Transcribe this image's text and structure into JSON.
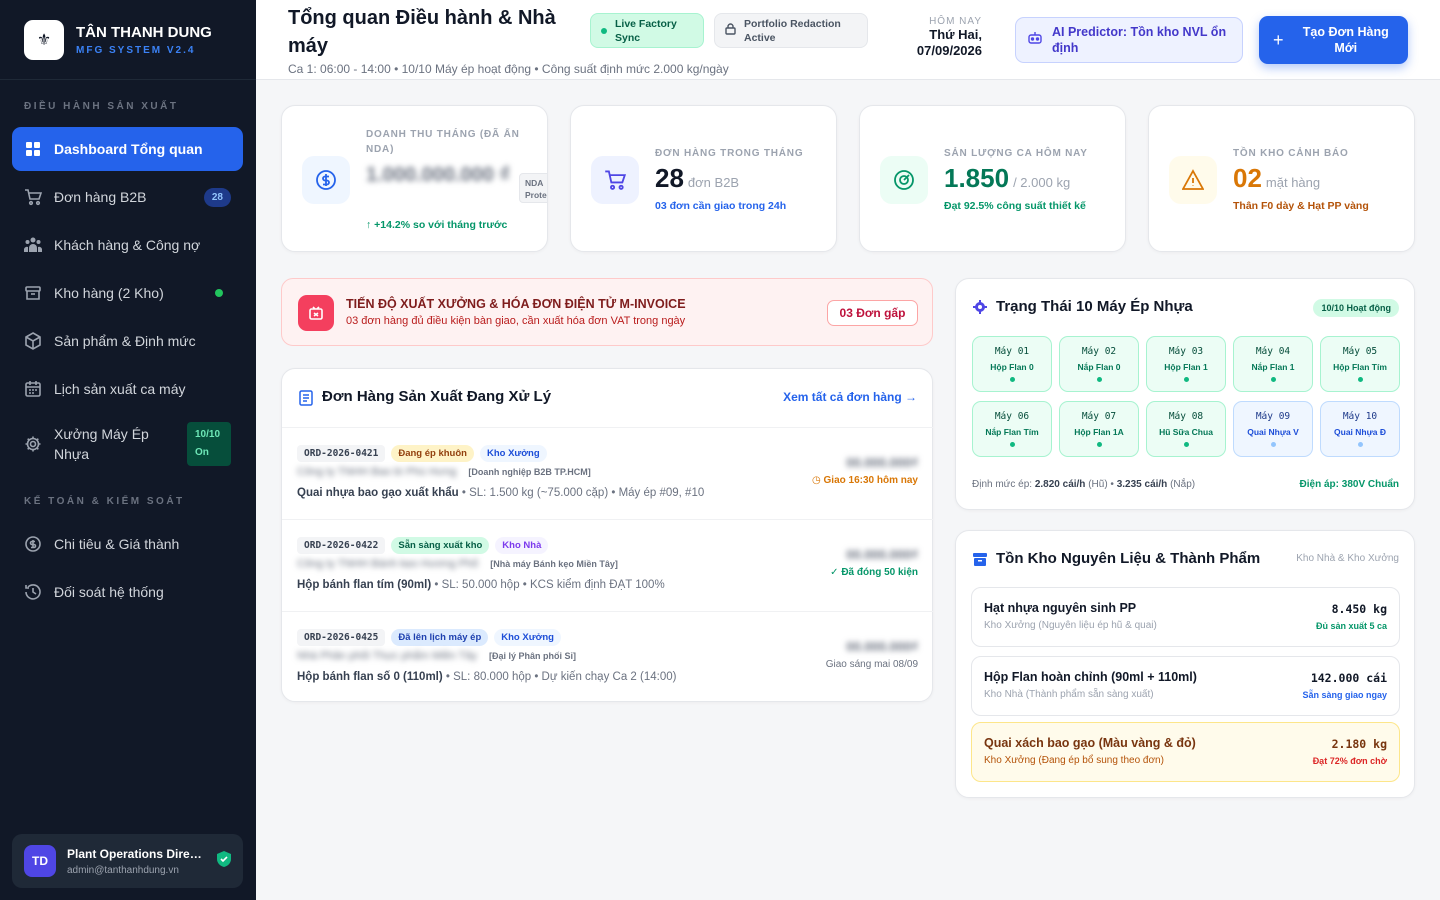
{
  "sidebar": {
    "brand_name": "TÂN THANH DUNG",
    "brand_sub": "MFG SYSTEM V2.4",
    "section1": "ĐIỀU HÀNH SẢN XUẤT",
    "section2": "KẾ TOÁN & KIỂM SOÁT",
    "items": [
      {
        "label": "Dashboard Tổng quan",
        "icon": "grid-icon"
      },
      {
        "label": "Đơn hàng B2B",
        "icon": "cart-icon",
        "badge": "28"
      },
      {
        "label": "Khách hàng & Công nợ",
        "icon": "users-icon"
      },
      {
        "label": "Kho hàng (2 Kho)",
        "icon": "archive-icon"
      },
      {
        "label": "Sản phẩm & Định mức",
        "icon": "box-icon"
      },
      {
        "label": "Lịch sản xuất ca máy",
        "icon": "calendar-icon"
      },
      {
        "label1": "Xưởng Máy Ép",
        "label2": "Nhựa",
        "icon": "gear-icon",
        "status1": "10/10",
        "status2": "On"
      },
      {
        "label": "Chi tiêu & Giá thành",
        "icon": "coin-icon"
      },
      {
        "label": "Đối soát hệ thống",
        "icon": "history-icon"
      }
    ],
    "user": {
      "initials": "TD",
      "name": "Plant Operations Director",
      "email": "admin@tanthanhdung.vn"
    }
  },
  "header": {
    "title": "Tổng quan Điều hành & Nhà máy",
    "subtitle": "Ca 1: 06:00 - 14:00 • 10/10 Máy ép hoạt động • Công suất định mức 2.000 kg/ngày",
    "chip_live_1": "Live Factory",
    "chip_live_2": "Sync",
    "chip_redact_1": "Portfolio Redaction",
    "chip_redact_2": "Active",
    "date_label": "HÔM NAY",
    "date_line1": "Thứ Hai,",
    "date_line2": "07/09/2026",
    "ai_text": "AI Predictor: Tồn kho NVL ổn định",
    "new_order_1": "Tạo Đơn Hàng",
    "new_order_2": "Mới"
  },
  "kpis": [
    {
      "label": "DOANH THU THÁNG (ĐÃ ẨN NDA)",
      "value": "1.000.000.000",
      "unit": "₫",
      "nda_1": "NDA",
      "nda_2": "Protected",
      "note": "+14.2% so với tháng trước",
      "color": "#059669"
    },
    {
      "label": "ĐƠN HÀNG TRONG THÁNG",
      "value": "28",
      "unit": "đơn B2B",
      "note": "03 đơn cần giao trong 24h",
      "color": "#2563eb"
    },
    {
      "label": "SẢN LƯỢNG CA HÔM NAY",
      "value": "1.850",
      "unit": "/ 2.000 kg",
      "note": "Đạt 92.5% công suất thiết kế",
      "color": "#059669"
    },
    {
      "label": "TỒN KHO CẢNH BÁO",
      "value": "02",
      "unit": "mặt hàng",
      "note": "Thân F0 dày & Hạt PP vàng",
      "color": "#d97706"
    }
  ],
  "alert": {
    "title": "TIẾN ĐỘ XUẤT XƯỞNG & HÓA ĐƠN ĐIỆN TỬ M-INVOICE",
    "subtitle": "03 đơn hàng đủ điều kiện bàn giao, cần xuất hóa đơn VAT trong ngày",
    "button": "03 Đơn gấp"
  },
  "orders": {
    "title": "Đơn Hàng Sản Xuất Đang Xử Lý",
    "view_all": "Xem tất cả đơn hàng →",
    "rows": [
      {
        "id": "ORD-2026-0421",
        "status": "Đang ép khuôn",
        "warehouse": "Kho Xưởng",
        "customer": "Công ty TNHH Bao bì Phú Hưng",
        "type": "[Doanh nghiệp B2B TP.HCM]",
        "product": "Quai nhựa bao gạo xuất khẩu",
        "details": " • SL: 1.500 kg (~75.000 cặp) • Máy ép #09, #10",
        "amount": "00.000.000₫",
        "deadline": "Giao 16:30 hôm nay"
      },
      {
        "id": "ORD-2026-0422",
        "status": "Sẵn sàng xuất kho",
        "warehouse": "Kho Nhà",
        "customer": "Công ty TNHH Bánh kẹo Hương Phố",
        "type": "[Nhà máy Bánh kẹo Miền Tây]",
        "product": "Hộp bánh flan tím (90ml)",
        "details": " • SL: 50.000 hộp • KCS kiểm định ĐẠT 100%",
        "amount": "00.000.000₫",
        "deadline": "Đã đóng 50 kiện"
      },
      {
        "id": "ORD-2026-0425",
        "status": "Đã lên lịch máy ép",
        "warehouse": "Kho Xưởng",
        "customer": "Nhà Phân phối Thực phẩm Miền Tây",
        "type": "[Đại lý Phân phối Sỉ]",
        "product": "Hộp bánh flan số 0 (110ml)",
        "details": " • SL: 80.000 hộp • Dự kiến chạy Ca 2 (14:00)",
        "amount": "00.000.000₫",
        "deadline": "Giao sáng mai 08/09"
      }
    ]
  },
  "machines": {
    "title": "Trạng Thái 10 Máy Ép Nhựa",
    "badge": "10/10 Hoạt động",
    "items": [
      {
        "name": "Máy 01",
        "product": "Hộp Flan 0"
      },
      {
        "name": "Máy 02",
        "product": "Nắp Flan 0"
      },
      {
        "name": "Máy 03",
        "product": "Hộp Flan 1"
      },
      {
        "name": "Máy 04",
        "product": "Nắp Flan 1"
      },
      {
        "name": "Máy 05",
        "product": "Hộp Flan Tím"
      },
      {
        "name": "Máy 06",
        "product": "Nắp Flan Tím"
      },
      {
        "name": "Máy 07",
        "product": "Hộp Flan 1A"
      },
      {
        "name": "Máy 08",
        "product": "Hũ Sữa Chua"
      },
      {
        "name": "Máy 09",
        "product": "Quai Nhựa V"
      },
      {
        "name": "Máy 10",
        "product": "Quai Nhựa Đ"
      }
    ],
    "footer_prefix": "Định mức ép: ",
    "footer_value1": "2.820 cái/h",
    "footer_mid": " (Hũ) • ",
    "footer_value2": "3.235 cái/h",
    "footer_suffix": " (Nắp)",
    "voltage": "Điện áp: 380V Chuẩn"
  },
  "inventory": {
    "title": "Tồn Kho Nguyên Liệu & Thành Phẩm",
    "scope": "Kho Nhà & Kho Xưởng",
    "items": [
      {
        "name": "Hạt nhựa nguyên sinh PP",
        "location": "Kho Xưởng (Nguyên liệu ép hũ & quai)",
        "qty": "8.450 kg",
        "status": "Đủ sản xuất 5 ca"
      },
      {
        "name": "Hộp Flan hoàn chỉnh (90ml + 110ml)",
        "location": "Kho Nhà (Thành phẩm sẵn sàng xuất)",
        "qty": "142.000 cái",
        "status": "Sẵn sàng giao ngay"
      },
      {
        "name": "Quai xách bao gạo (Màu vàng & đỏ)",
        "location": "Kho Xưởng (Đang ép bổ sung theo đơn)",
        "qty": "2.180 kg",
        "status": "Đạt 72% đơn chờ"
      }
    ]
  }
}
